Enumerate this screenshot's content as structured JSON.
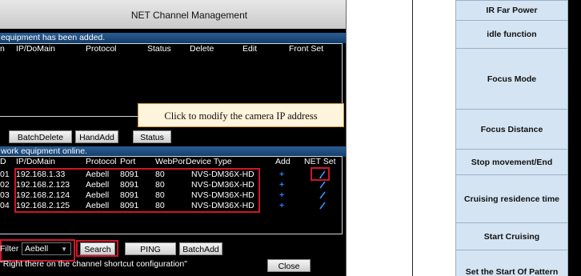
{
  "dialog": {
    "title": "NET Channel Management",
    "added_section": {
      "caption": "equipment has been added.",
      "headers": [
        "n",
        "IP/DoMain",
        "Protocol",
        "Status",
        "Delete",
        "Edit",
        "Front Set"
      ],
      "buttons": {
        "batch_delete": "BatchDelete",
        "hand_add": "HandAdd",
        "status": "Status"
      }
    },
    "online_section": {
      "caption": "work equipment online.",
      "headers": [
        "D",
        "IP/DoMain",
        "Protocol",
        "Port",
        "WebPor",
        "Device Type",
        "Add",
        "NET Set"
      ],
      "rows": [
        {
          "id": "01",
          "ip": "192.168.1.33",
          "protocol": "Aebell",
          "port": "8091",
          "webport": "80",
          "type": "NVS-DM36X-HD",
          "add": "+"
        },
        {
          "id": "02",
          "ip": "192.168.2.123",
          "protocol": "Aebell",
          "port": "8091",
          "webport": "80",
          "type": "NVS-DM36X-HD",
          "add": "+"
        },
        {
          "id": "03",
          "ip": "192.168.2.124",
          "protocol": "Aebell",
          "port": "8091",
          "webport": "80",
          "type": "NVS-DM36X-HD",
          "add": "+"
        },
        {
          "id": "04",
          "ip": "192.168.2.125",
          "protocol": "Aebell",
          "port": "8091",
          "webport": "80",
          "type": "NVS-DM36X-HD",
          "add": "+"
        }
      ]
    },
    "filter": {
      "label": "Filter",
      "value": "Aebell"
    },
    "buttons": {
      "search": "Search",
      "ping": "PING",
      "batch_add": "BatchAdd",
      "close": "Close"
    },
    "hint": "\"Right there on the channel shortcut configuration\"",
    "callout": "Click to modify the camera IP address",
    "colors": {
      "section_bar": "#1f4f82",
      "highlight": "#d0152a",
      "add_plus": "#2f7bff"
    }
  },
  "right_table": {
    "rows": [
      "IR Far Power",
      "idle function",
      "Focus Mode",
      "Focus Distance",
      "Stop movement/End",
      "Cruising residence time",
      "Start Cruising",
      "Set the Start Of Pattern"
    ],
    "cell_color": "#d5e4f3"
  }
}
